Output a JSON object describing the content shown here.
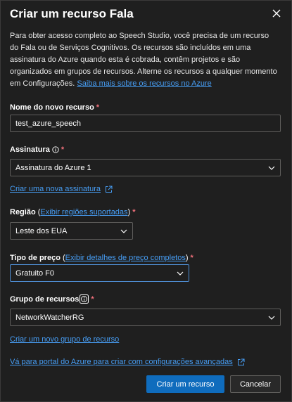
{
  "dialog": {
    "title": "Criar um recurso Fala",
    "description": "Para obter acesso completo ao Speech Studio, você precisa de um recurso do Fala ou de Serviços Cognitivos. Os recursos são incluídos em uma assinatura do Azure quando esta é cobrada, contêm projetos e são organizados em grupos de recursos. Alterne os recursos a qualquer momento em Configurações.",
    "learn_more_link": "Saiba mais sobre os recursos no Azure"
  },
  "resource_name": {
    "label": "Nome do novo recurso",
    "required": "*",
    "value": "test_azure_speech"
  },
  "subscription": {
    "label": "Assinatura",
    "required": "*",
    "value": "Assinatura do Azure 1",
    "create_link": "Criar uma nova assinatura"
  },
  "region": {
    "label": "Região",
    "paren_open": "(",
    "link": "Exibir regiões suportadas",
    "paren_close": ")",
    "required": "*",
    "value": "Leste dos EUA"
  },
  "pricing": {
    "label": "Tipo de preço",
    "paren_open": "(",
    "link": "Exibir detalhes de preço completos",
    "paren_close": ")",
    "required": "*",
    "value": "Gratuito F0"
  },
  "resource_group": {
    "label": "Grupo de recursos",
    "required": "*",
    "value": "NetworkWatcherRG",
    "create_link": "Criar um novo grupo de recurso"
  },
  "portal_link": "Vá para portal do Azure para criar com configurações avançadas",
  "buttons": {
    "create": "Criar um recurso",
    "cancel": "Cancelar"
  },
  "colors": {
    "accent": "#0f6cbd",
    "link": "#479ef5",
    "required": "#f1707b"
  }
}
